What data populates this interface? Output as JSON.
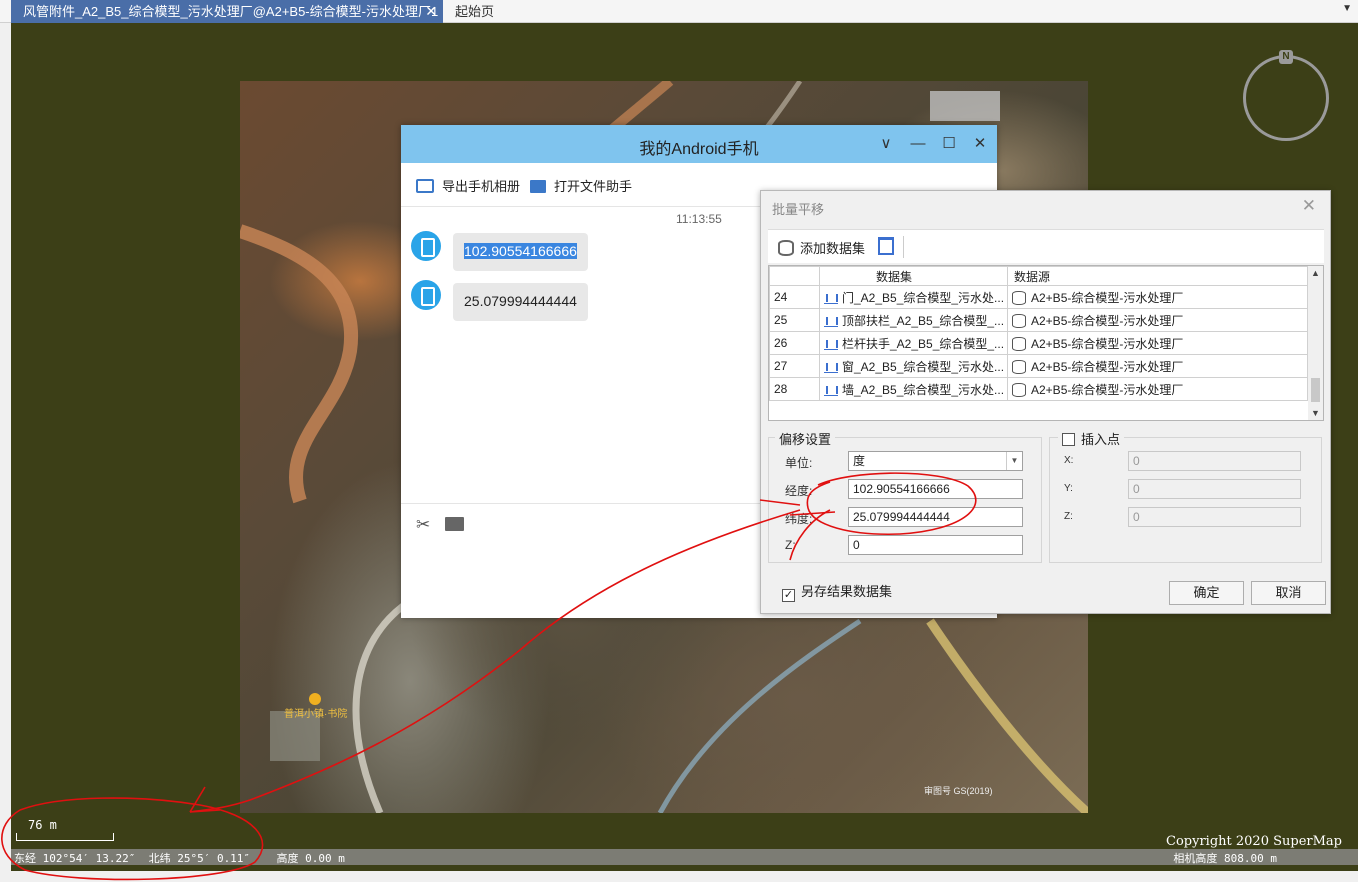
{
  "tabs": [
    {
      "label": "风管附件_A2_B5_综合模型_污水处理厂@A2+B5-综合模型-污水处理厂1",
      "close": "✕"
    },
    {
      "label": "起始页"
    }
  ],
  "tab_menu_icon": "▼",
  "map": {
    "compass_label": "N",
    "scale_label": "76 m",
    "copyright": "Copyright 2020 SuperMap",
    "coordinates": "东经 102°54′ 13.22″  北纬 25°5′ 0.11″    高度 0.00 m",
    "camera_height": "相机高度 808.00 m",
    "imagery_credit": "审图号 GS(2019)",
    "poi_label": "普洱小镇·书院"
  },
  "phone_window": {
    "title": "我的Android手机",
    "buttons": {
      "dropdown": "∨",
      "minimize": "—",
      "maximize": "☐",
      "close": "✕"
    },
    "toolbar": {
      "export_album": "导出手机相册",
      "open_file_helper": "打开文件助手"
    },
    "chat_time": "11:13:55",
    "messages": [
      "102.90554166666",
      "25.079994444444"
    ],
    "input_icons": [
      "scissors-icon",
      "folder-icon"
    ]
  },
  "batch_dialog": {
    "title": "批量平移",
    "close": "✕",
    "add_dataset": "添加数据集",
    "columns": [
      "",
      "数据集",
      "数据源"
    ],
    "rows": [
      {
        "num": "24",
        "dataset": "门_A2_B5_综合模型_污水处...",
        "source": "A2+B5-综合模型-污水处理厂"
      },
      {
        "num": "25",
        "dataset": "顶部扶栏_A2_B5_综合模型_...",
        "source": "A2+B5-综合模型-污水处理厂"
      },
      {
        "num": "26",
        "dataset": "栏杆扶手_A2_B5_综合模型_...",
        "source": "A2+B5-综合模型-污水处理厂"
      },
      {
        "num": "27",
        "dataset": "窗_A2_B5_综合模型_污水处...",
        "source": "A2+B5-综合模型-污水处理厂"
      },
      {
        "num": "28",
        "dataset": "墙_A2_B5_综合模型_污水处...",
        "source": "A2+B5-综合模型-污水处理厂"
      }
    ],
    "offset": {
      "title": "偏移设置",
      "unit_label": "单位:",
      "unit_value": "度",
      "lon_label": "经度:",
      "lon_value": "102.90554166666",
      "lat_label": "纬度:",
      "lat_value": "25.079994444444",
      "z_label": "Z:",
      "z_value": "0"
    },
    "insert_point": {
      "title": "插入点",
      "checked": false,
      "x_label": "X:",
      "x_value": "0",
      "y_label": "Y:",
      "y_value": "0",
      "z_label": "Z:",
      "z_value": "0"
    },
    "save_result": {
      "label": "另存结果数据集",
      "checked": true
    },
    "ok": "确定",
    "cancel": "取消"
  },
  "colors": {
    "annotation": "#e01010",
    "phone_title_bg": "#7fc4ee",
    "tab_active_bg": "#4a6ea8",
    "map_bg": "#3c3f17"
  }
}
